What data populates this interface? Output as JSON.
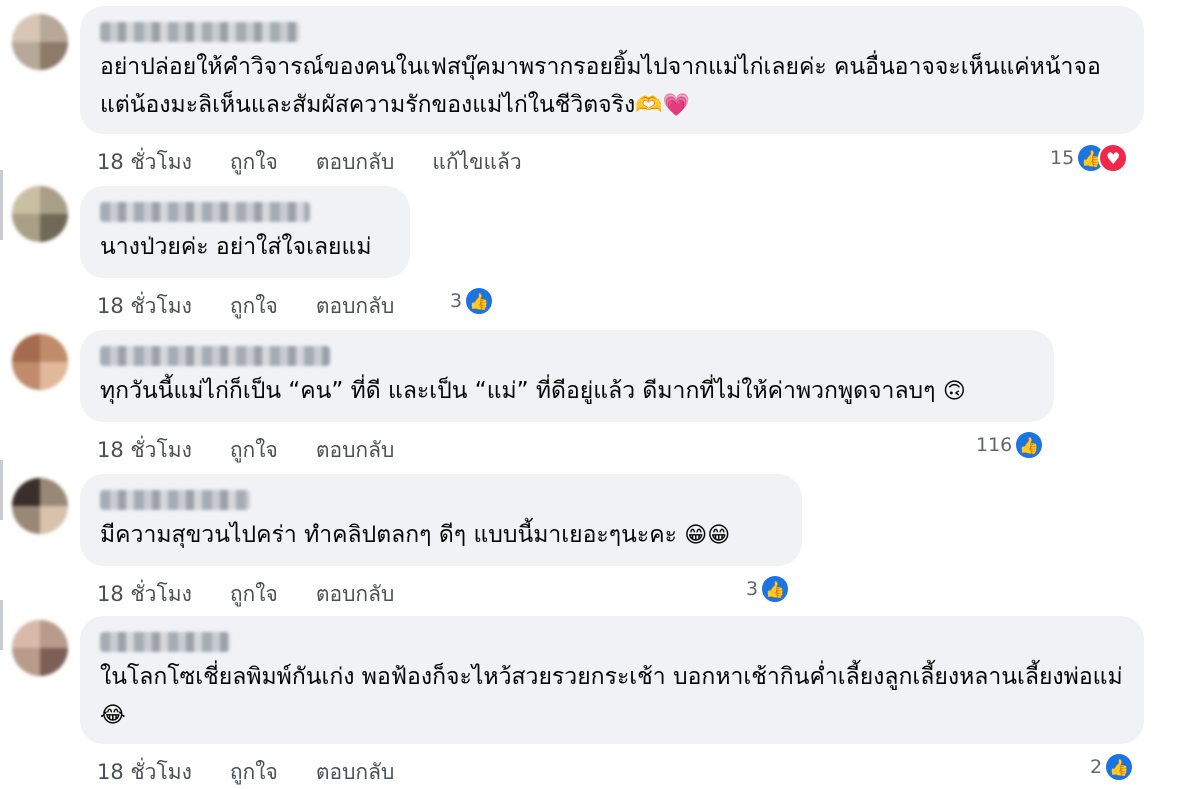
{
  "comments": [
    {
      "name_blurred": true,
      "text": "อย่าปล่อยให้คำวิจารณ์ของคนในเฟสบุ๊คมาพรากรอยยิ้มไปจากแม่ไก่เลยค่ะ คนอื่นอาจจะเห็นแค่หน้าจอ แต่น้องมะลิเห็นและสัมผัสความรักของแม่ไก่ในชีวิตจริง",
      "emojis": "🫶💗",
      "time": "18 ชั่วโมง",
      "like": "ถูกใจ",
      "reply": "ตอบกลับ",
      "edited": "แก้ไขแล้ว",
      "reaction_count": "15",
      "reaction_icons": [
        "like-icon",
        "love-icon"
      ]
    },
    {
      "name_blurred": true,
      "text": "นางป่วยค่ะ อย่าใส่ใจเลยแม่",
      "emojis": "",
      "time": "18 ชั่วโมง",
      "like": "ถูกใจ",
      "reply": "ตอบกลับ",
      "reaction_count": "3",
      "reaction_icons": [
        "like-icon"
      ]
    },
    {
      "name_blurred": true,
      "text": "ทุกวันนี้แม่ไก่ก็เป็น “คน” ที่ดี และเป็น “แม่” ที่ดีอยู่แล้ว ดีมากที่ไม่ให้ค่าพวกพูดจาลบๆ",
      "emojis": "🙃",
      "time": "18 ชั่วโมง",
      "like": "ถูกใจ",
      "reply": "ตอบกลับ",
      "reaction_count": "116",
      "reaction_icons": [
        "like-icon"
      ]
    },
    {
      "name_blurred": true,
      "text": "มีความสุขวนไปคร่า ทำคลิปตลกๆ ดีๆ แบบนี้มาเยอะๆนะคะ",
      "emojis": "😁😁",
      "time": "18 ชั่วโมง",
      "like": "ถูกใจ",
      "reply": "ตอบกลับ",
      "reaction_count": "3",
      "reaction_icons": [
        "like-icon"
      ]
    },
    {
      "name_blurred": true,
      "text": "ในโลกโซเชี่ยลพิมพ์กันเก่ง พอฟ้องก็จะไหว้สวยรวยกระเช้า บอกหาเช้ากินค่ำเลี้ยงลูกเลี้ยงหลานเลี้ยงพ่อแม่",
      "emojis": "😂",
      "time": "18 ชั่วโมง",
      "like": "ถูกใจ",
      "reply": "ตอบกลับ",
      "reaction_count": "2",
      "reaction_icons": [
        "like-icon"
      ]
    }
  ],
  "colors": {
    "bubble": "#f0f2f5",
    "like": "#1b74e4",
    "love": "#f02849",
    "meta": "#4b4f56"
  }
}
